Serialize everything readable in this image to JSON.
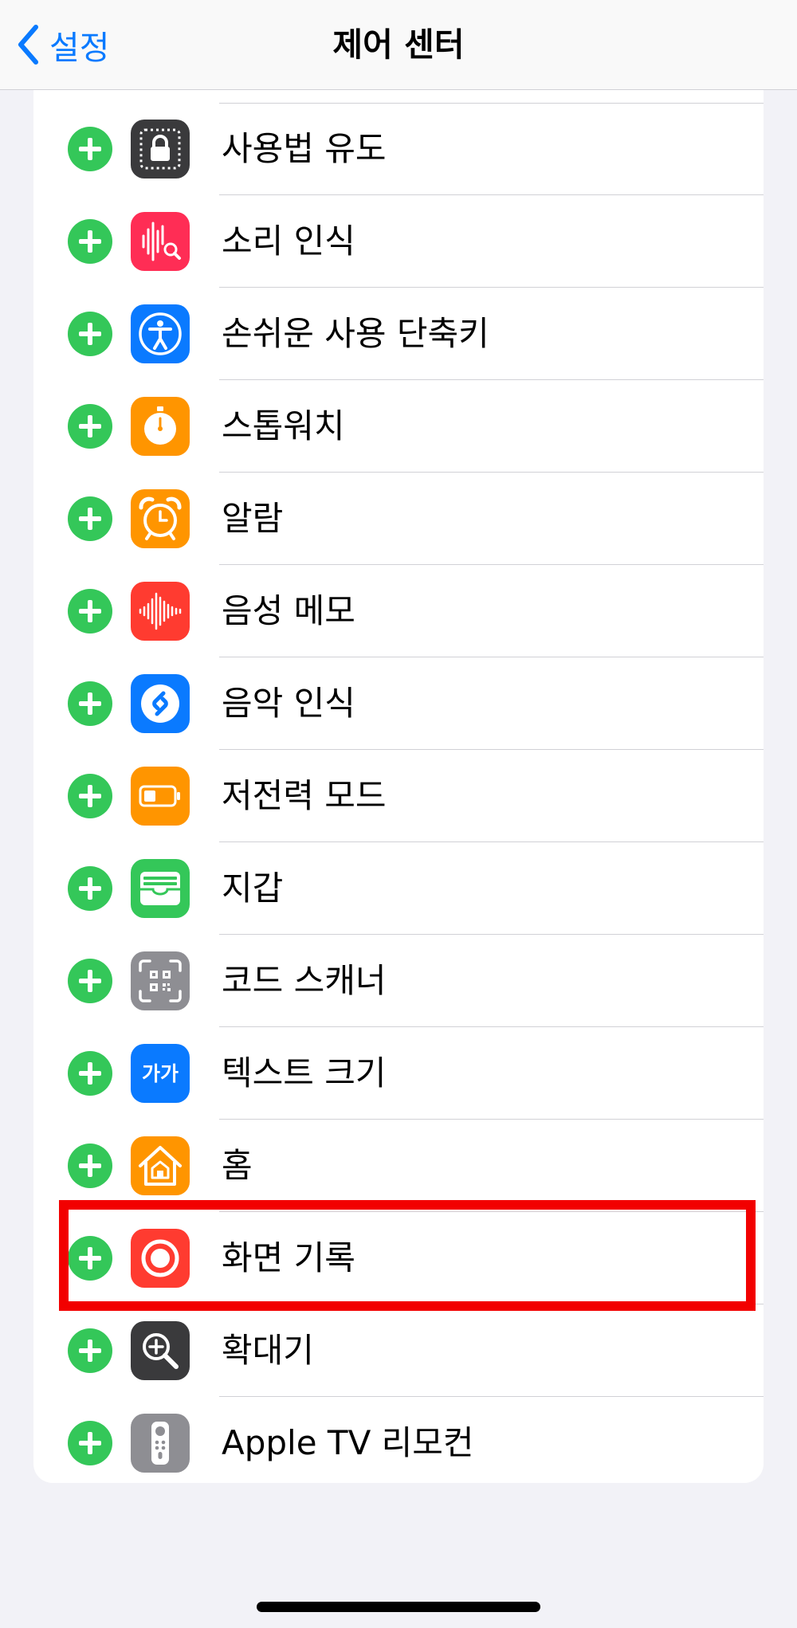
{
  "nav": {
    "back_label": "설정",
    "title": "제어 센터"
  },
  "rows": [
    {
      "label": "사용법 유도",
      "icon": "guided-access-lock-icon",
      "color": "#3A3A3C"
    },
    {
      "label": "소리 인식",
      "icon": "sound-recognition-icon",
      "color": "#FF2D55"
    },
    {
      "label": "손쉬운 사용 단축키",
      "icon": "accessibility-icon",
      "color": "#0A7AFF"
    },
    {
      "label": "스톱워치",
      "icon": "stopwatch-icon",
      "color": "#FF9500"
    },
    {
      "label": "알람",
      "icon": "alarm-clock-icon",
      "color": "#FF9500"
    },
    {
      "label": "음성 메모",
      "icon": "voice-memo-waveform-icon",
      "color": "#FF3B30"
    },
    {
      "label": "음악 인식",
      "icon": "shazam-icon",
      "color": "#0A7AFF"
    },
    {
      "label": "저전력 모드",
      "icon": "battery-icon",
      "color": "#FF9500"
    },
    {
      "label": "지갑",
      "icon": "wallet-icon",
      "color": "#34C759"
    },
    {
      "label": "코드 스캐너",
      "icon": "qr-code-scanner-icon",
      "color": "#8E8E93"
    },
    {
      "label": "텍스트 크기",
      "icon": "text-size-icon",
      "color": "#0A7AFF",
      "icon_text": "가가"
    },
    {
      "label": "홈",
      "icon": "home-icon",
      "color": "#FF9500"
    },
    {
      "label": "화면 기록",
      "icon": "screen-recording-icon",
      "color": "#FF3B30",
      "highlighted": true
    },
    {
      "label": "확대기",
      "icon": "magnifier-icon",
      "color": "#3A3A3C"
    },
    {
      "label": "Apple TV 리모컨",
      "icon": "apple-tv-remote-icon",
      "color": "#8E8E93"
    }
  ],
  "colors": {
    "accent": "#0A7AFF",
    "add_button": "#34C759",
    "highlight_box": "#F20000",
    "background": "#F2F2F7"
  }
}
